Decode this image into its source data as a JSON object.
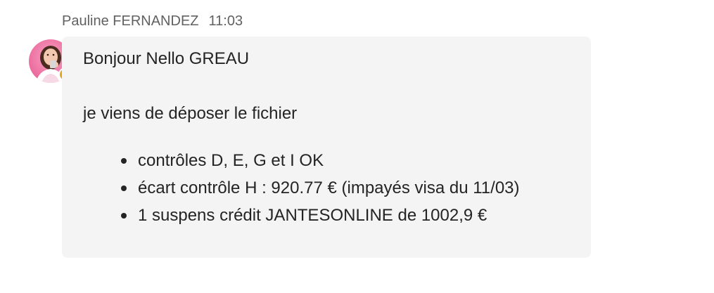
{
  "message": {
    "sender_name": "Pauline FERNANDEZ",
    "timestamp": "11:03",
    "avatar": {
      "icon": "user-avatar-photo",
      "presence_status": "away",
      "presence_color": "#e8a317"
    },
    "greeting": "Bonjour Nello GREAU",
    "intro": "je viens de déposer le fichier",
    "bullets": [
      "contrôles D, E, G et I OK",
      "écart contrôle H : 920.77 € (impayés visa du 11/03)",
      "1 suspens crédit JANTESONLINE de 1002,9 €"
    ]
  },
  "colors": {
    "bubble_background": "#f4f4f4",
    "text": "#242424",
    "meta_text": "#616161"
  }
}
